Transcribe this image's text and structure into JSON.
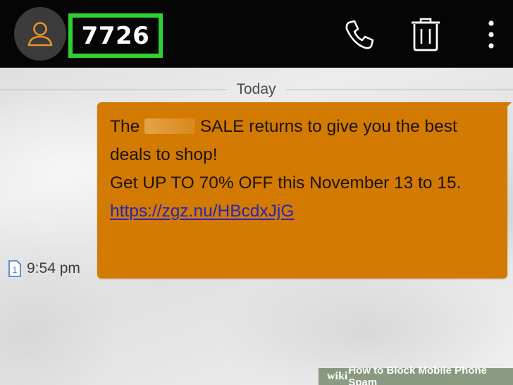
{
  "header": {
    "title": "7726",
    "highlight_color": "#2fd12f",
    "icons": [
      "contact-avatar-icon",
      "phone-icon",
      "trash-icon",
      "more-vert-icon"
    ]
  },
  "conversation": {
    "date_divider": "Today",
    "message": {
      "line1_before": "The",
      "line1_after": "SALE returns to give you the best",
      "line2": "deals to shop!",
      "line3": "Get UP TO 70% OFF this November 13 to 15.",
      "link": "https://zgz.nu/HBcdxJjG",
      "sim_slot": "1",
      "time": "9:54 pm",
      "bubble_color": "#d27a02"
    }
  },
  "watermark": {
    "brand": "wiki",
    "text": "How to Block Mobile Phone Spam"
  }
}
